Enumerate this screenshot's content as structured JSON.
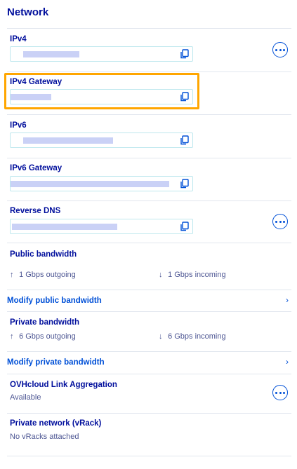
{
  "page": {
    "title": "Network"
  },
  "ipv4": {
    "label": "IPv4"
  },
  "ipv4_gateway": {
    "label": "IPv4 Gateway"
  },
  "ipv6": {
    "label": "IPv6"
  },
  "ipv6_gateway": {
    "label": "IPv6 Gateway"
  },
  "reverse_dns": {
    "label": "Reverse DNS"
  },
  "public_bandwidth": {
    "label": "Public bandwidth",
    "outgoing": "1 Gbps outgoing",
    "incoming": "1 Gbps incoming",
    "modify_link": "Modify public bandwidth"
  },
  "private_bandwidth": {
    "label": "Private bandwidth",
    "outgoing": "6 Gbps outgoing",
    "incoming": "6 Gbps incoming",
    "modify_link": "Modify private bandwidth"
  },
  "link_aggregation": {
    "label": "OVHcloud Link Aggregation",
    "status": "Available"
  },
  "vrack": {
    "label": "Private network (vRack)",
    "status": "No vRacks attached"
  },
  "icons": {
    "copy": "copy-icon",
    "more": "more-options-icon",
    "up": "arrow-up-icon",
    "down": "arrow-down-icon",
    "chevron": "chevron-right-icon"
  },
  "colors": {
    "primary": "#000e9c",
    "link": "#0050d7",
    "highlight": "#ffa600"
  }
}
